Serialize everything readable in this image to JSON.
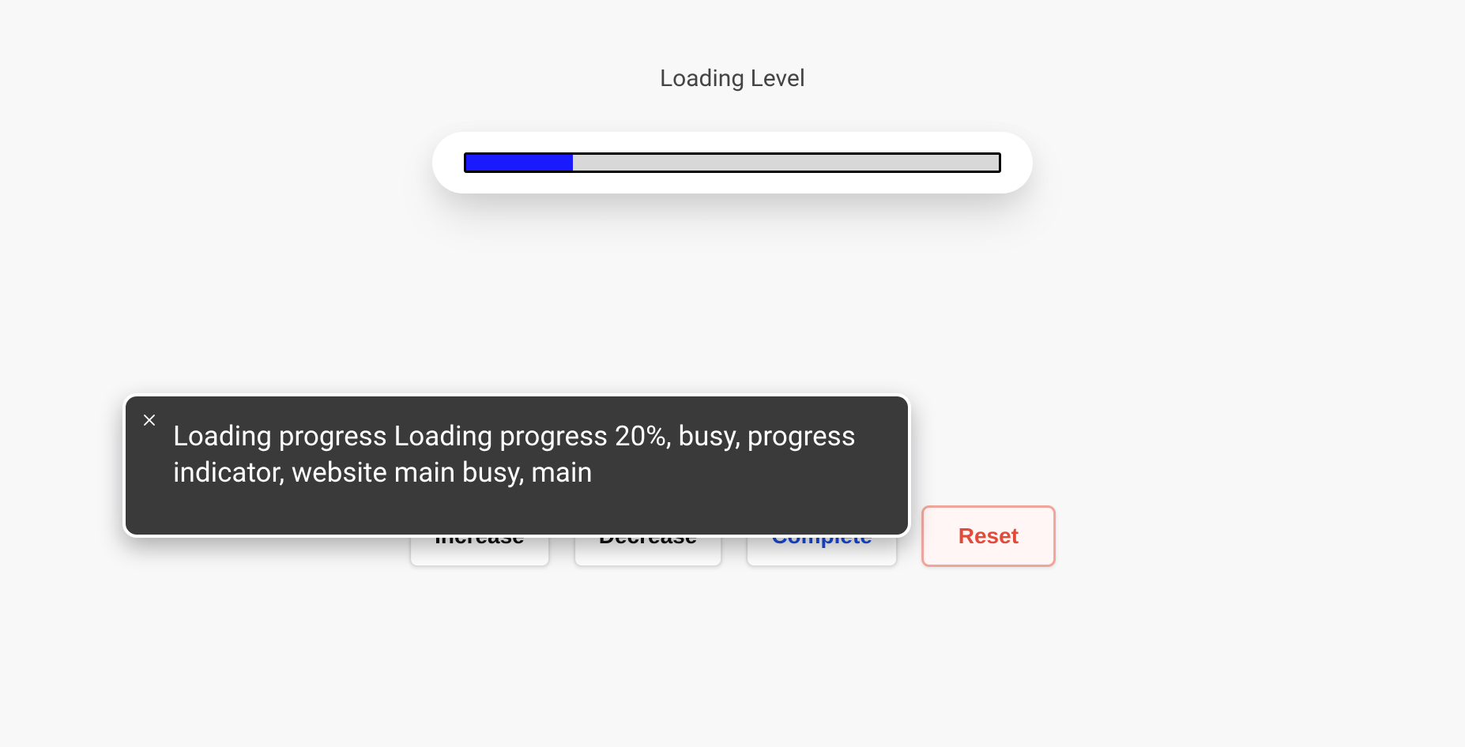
{
  "title": "Loading Level",
  "progress": {
    "percent": 20
  },
  "buttons": {
    "increase": "Increase",
    "decrease": "Decrease",
    "complete": "Complete",
    "reset": "Reset"
  },
  "tooltip": {
    "text": "Loading progress Loading progress 20%, busy, progress indicator, website main busy, main"
  }
}
